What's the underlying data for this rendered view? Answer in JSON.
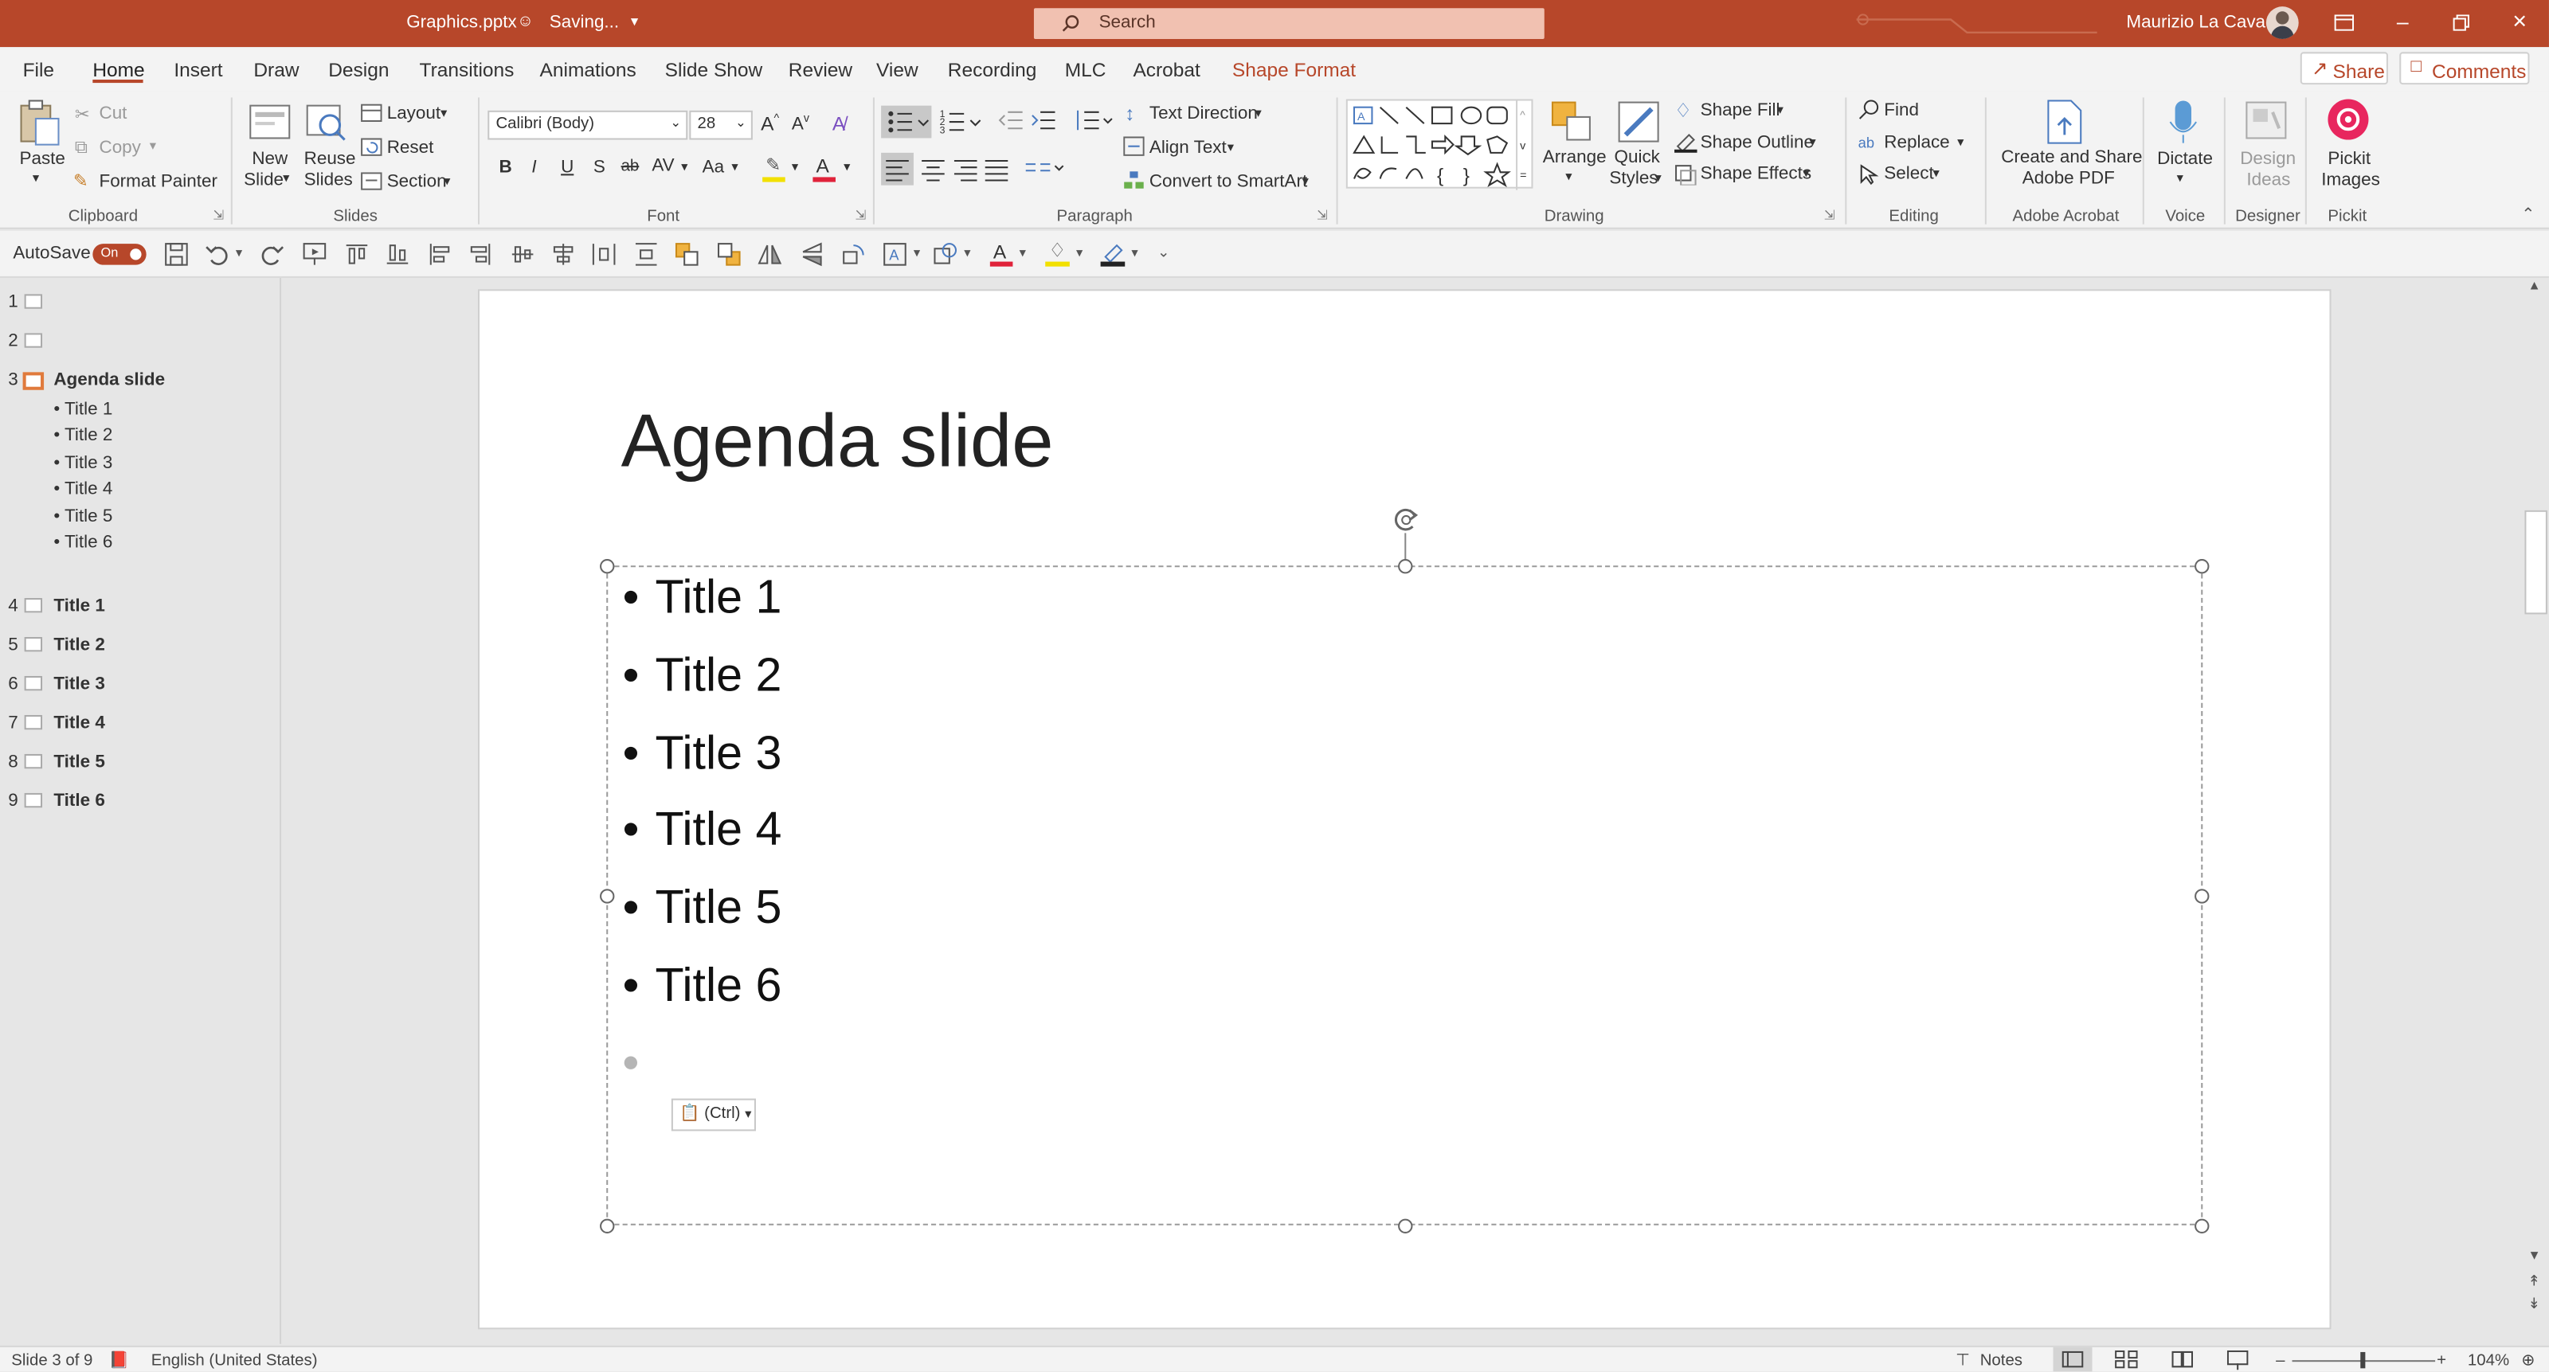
{
  "titlebar": {
    "filename": "Graphics.pptx",
    "status": "Saving...",
    "search_placeholder": "Search",
    "user_name": "Maurizio La Cava",
    "brand_color": "#b7472a"
  },
  "tabs": [
    "File",
    "Home",
    "Insert",
    "Draw",
    "Design",
    "Transitions",
    "Animations",
    "Slide Show",
    "Review",
    "View",
    "Recording",
    "MLC",
    "Acrobat",
    "Shape Format"
  ],
  "share_label": "Share",
  "comments_label": "Comments",
  "ribbon": {
    "clipboard": {
      "paste": "Paste",
      "cut": "Cut",
      "copy": "Copy",
      "format_painter": "Format Painter",
      "group": "Clipboard"
    },
    "slides": {
      "new_slide_1": "New",
      "new_slide_2": "Slide",
      "reuse_1": "Reuse",
      "reuse_2": "Slides",
      "layout": "Layout",
      "reset": "Reset",
      "section": "Section",
      "group": "Slides"
    },
    "font": {
      "name": "Calibri (Body)",
      "size": "28",
      "group": "Font"
    },
    "paragraph": {
      "text_direction": "Text Direction",
      "align_text": "Align Text",
      "smartart": "Convert to SmartArt",
      "group": "Paragraph"
    },
    "drawing": {
      "arrange": "Arrange",
      "quick_1": "Quick",
      "quick_2": "Styles",
      "shape_fill": "Shape Fill",
      "shape_outline": "Shape Outline",
      "shape_effects": "Shape Effects",
      "group": "Drawing"
    },
    "editing": {
      "find": "Find",
      "replace": "Replace",
      "select": "Select",
      "group": "Editing"
    },
    "acrobat": {
      "line1": "Create and Share",
      "line2": "Adobe PDF",
      "group": "Adobe Acrobat"
    },
    "voice": {
      "dictate": "Dictate",
      "group": "Voice"
    },
    "designer": {
      "line1": "Design",
      "line2": "Ideas",
      "group": "Designer"
    },
    "pickit": {
      "line1": "Pickit",
      "line2": "Images",
      "group": "Pickit"
    }
  },
  "qat": {
    "autosave": "AutoSave",
    "toggle": "On"
  },
  "outline": {
    "slide3_title": "Agenda slide",
    "slide3_items": [
      "• Title 1",
      "• Title 2",
      "• Title 3",
      "• Title 4",
      "• Title 5",
      "• Title 6"
    ],
    "slides": [
      {
        "num": "1",
        "title": ""
      },
      {
        "num": "2",
        "title": ""
      },
      {
        "num": "3",
        "title": "Agenda slide"
      },
      {
        "num": "4",
        "title": "Title 1"
      },
      {
        "num": "5",
        "title": "Title 2"
      },
      {
        "num": "6",
        "title": "Title 3"
      },
      {
        "num": "7",
        "title": "Title 4"
      },
      {
        "num": "8",
        "title": "Title 5"
      },
      {
        "num": "9",
        "title": "Title 6"
      }
    ]
  },
  "slide": {
    "title": "Agenda slide",
    "bullets": [
      "Title 1",
      "Title 2",
      "Title 3",
      "Title 4",
      "Title 5",
      "Title 6"
    ],
    "paste_options": "(Ctrl)"
  },
  "status": {
    "slide_counter": "Slide 3 of 9",
    "language": "English (United States)",
    "notes": "Notes",
    "zoom": "104%"
  }
}
